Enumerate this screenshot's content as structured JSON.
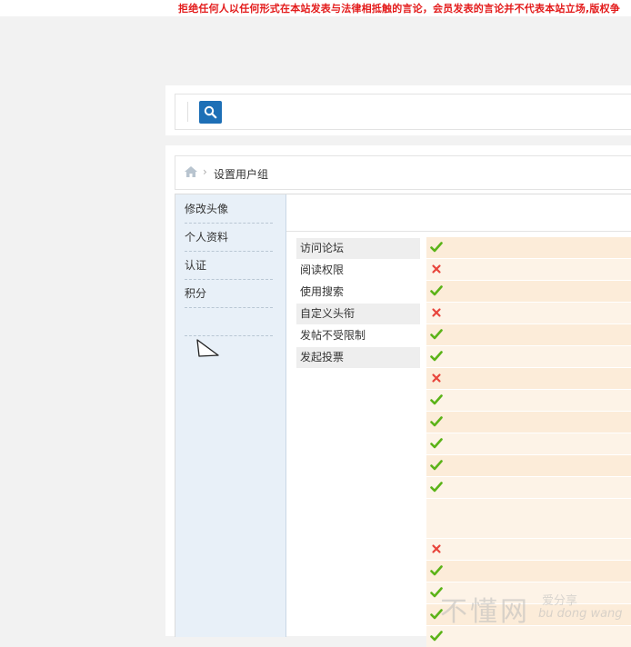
{
  "notice": {
    "text": "拒绝任何人以任何形式在本站发表与法律相抵触的言论，会员发表的言论并不代表本站立场,版权争"
  },
  "search": {
    "button_icon": "search-icon",
    "accent": "#1d6fb6"
  },
  "breadcrumb": {
    "home_icon": "home-icon",
    "separator": "›",
    "current": "设置用户组"
  },
  "sidebar": {
    "items": [
      {
        "label": "修改头像"
      },
      {
        "label": "个人资料"
      },
      {
        "label": "认证"
      },
      {
        "label": "积分"
      }
    ]
  },
  "permissions": {
    "labels": [
      "访问论坛",
      "阅读权限",
      "使用搜索",
      "自定义头衔",
      "发帖不受限制",
      "发起投票"
    ],
    "marks": [
      "yes",
      "no",
      "yes",
      "no",
      "yes",
      "yes",
      "no",
      "yes",
      "yes",
      "yes",
      "yes",
      "yes",
      "",
      "no",
      "yes",
      "yes",
      "yes",
      "yes"
    ],
    "colors": {
      "yes": "#5bb318",
      "no": "#e8453c"
    }
  },
  "watermark": {
    "main": "不懂网",
    "sub1": "爱分享",
    "sub2": "bu dong wang"
  }
}
